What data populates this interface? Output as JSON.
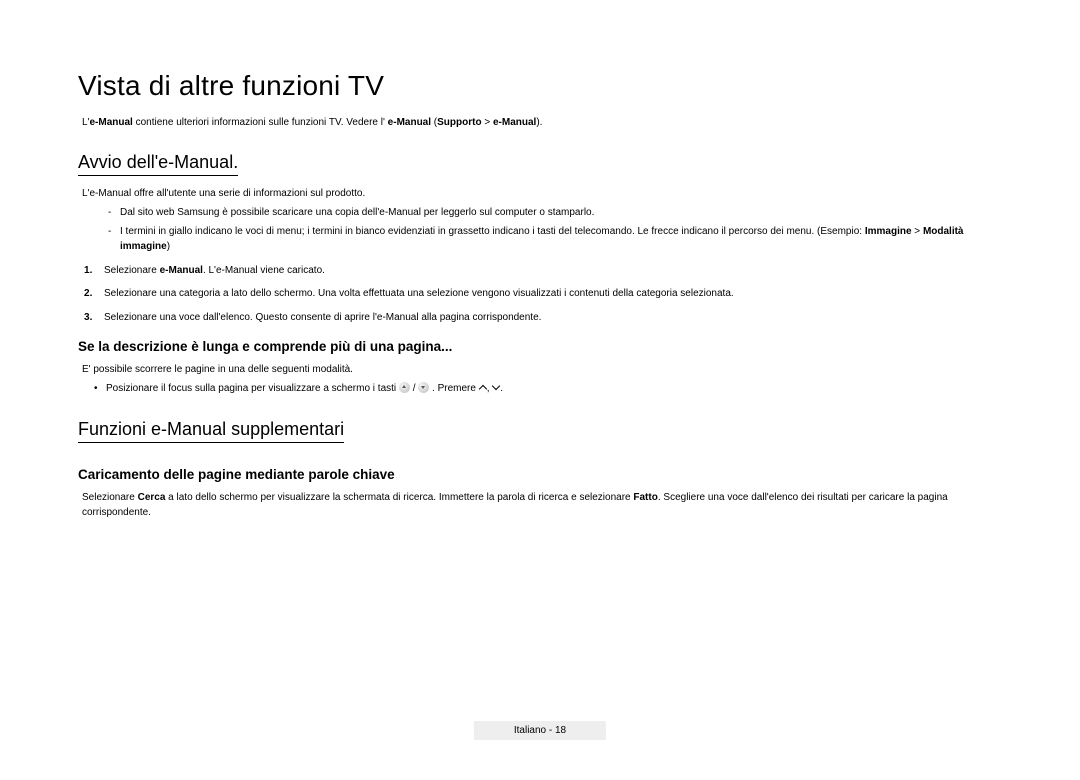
{
  "title": "Vista di altre funzioni TV",
  "intro": {
    "pre": "L'",
    "bold1": "e-Manual",
    "mid": " contiene ulteriori informazioni sulle funzioni TV. Vedere l' ",
    "bold2": "e-Manual",
    "paren_open": " (",
    "bold3": "Supporto",
    "gt": " > ",
    "bold4": "e-Manual",
    "paren_close": ")."
  },
  "section1": {
    "heading": "Avvio dell'e-Manual.",
    "p1": "L'e-Manual offre all'utente una serie di informazioni sul prodotto.",
    "dash1": "Dal sito web Samsung è possibile scaricare una copia dell'e-Manual per leggerlo sul computer o stamparlo.",
    "dash2_a": "I termini in giallo indicano le voci di menu; i termini in bianco evidenziati in grassetto indicano i tasti del telecomando. Le frecce indicano il percorso dei menu. (Esempio: ",
    "dash2_b1": "Immagine",
    "dash2_gt": " > ",
    "dash2_b2": "Modalità immagine",
    "dash2_close": ")",
    "step1_a": "Selezionare ",
    "step1_b": "e-Manual",
    "step1_c": ". L'e-Manual viene caricato.",
    "step2": "Selezionare una categoria a lato dello schermo. Una volta effettuata una selezione vengono visualizzati i contenuti della categoria selezionata.",
    "step3": "Selezionare una voce dall'elenco. Questo consente di aprire l'e-Manual alla pagina corrispondente.",
    "sub_heading": "Se la descrizione è lunga e comprende più di una pagina...",
    "sub_p": "E' possibile scorrere le pagine in una delle seguenti modalità.",
    "bullet_a": "Posizionare il focus sulla pagina per visualizzare a schermo i tasti ",
    "bullet_mid": " / ",
    "bullet_b": " . Premere ",
    "bullet_comma": ", ",
    "bullet_end": "."
  },
  "section2": {
    "heading": "Funzioni e-Manual supplementari",
    "sub_heading": "Caricamento delle pagine mediante parole chiave",
    "p_a": "Selezionare ",
    "p_b1": "Cerca",
    "p_c": " a lato dello schermo per visualizzare la schermata di ricerca. Immettere la parola di ricerca e selezionare ",
    "p_b2": "Fatto",
    "p_d": ". Scegliere una voce dall'elenco dei risultati per caricare la pagina corrispondente."
  },
  "footer": "Italiano - 18"
}
